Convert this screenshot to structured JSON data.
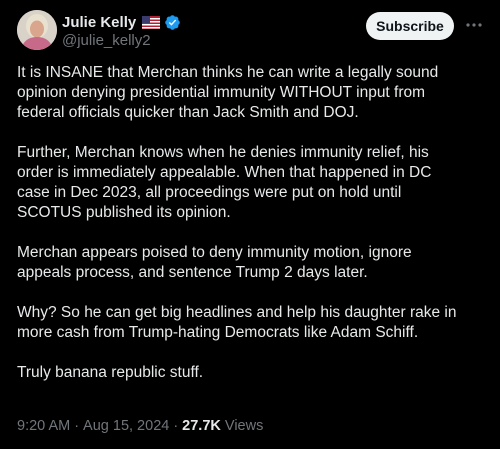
{
  "author": {
    "name": "Julie Kelly",
    "handle": "@julie_kelly2",
    "flag_icon": "us-flag-icon",
    "verified_icon": "verified-badge-icon",
    "verified_color": "#1d9bf0"
  },
  "actions": {
    "subscribe_label": "Subscribe",
    "more_icon": "more-icon"
  },
  "tweet": {
    "paragraphs": [
      "It is INSANE that Merchan thinks he can write a legally sound\nopinion denying presidential immunity WITHOUT input from\nfederal officials quicker than Jack Smith and DOJ.",
      "Further, Merchan knows when he denies immunity relief, his\norder is immediately appealable. When that happened in DC\ncase in Dec 2023, all proceedings were put on hold until\nSCOTUS published its opinion.",
      "Merchan appears poised to deny immunity motion, ignore\nappeals process, and sentence Trump 2 days later.",
      "Why? So he can get big headlines and help his daughter rake in\nmore cash from Trump-hating Democrats like Adam Schiff.",
      "Truly banana republic stuff."
    ]
  },
  "meta": {
    "time": "9:20 AM",
    "separator": "·",
    "date": "Aug 15, 2024",
    "views_count": "27.7K",
    "views_label": "Views"
  }
}
